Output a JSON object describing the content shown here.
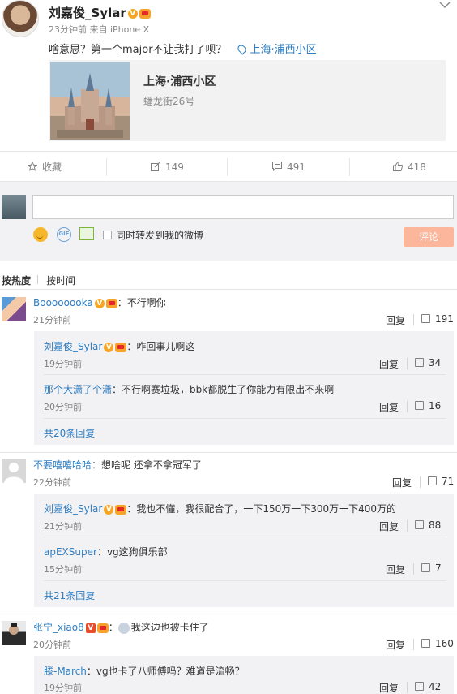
{
  "post": {
    "author": "刘嘉俊_Sylar",
    "meta": "23分钟前 来自 iPhone X",
    "text": "啥意思？第一个major不让我打了呗？",
    "location_link": "上海·浦西小区",
    "location_card": {
      "title": "上海·浦西小区",
      "address": "蟠龙街26号"
    }
  },
  "actions": {
    "favorite": "收藏",
    "forward": "149",
    "comment": "491",
    "like": "418"
  },
  "compose": {
    "forward_label": "同时转发到我的微博",
    "submit": "评论"
  },
  "sort": {
    "hot": "按热度",
    "time": "按时间"
  },
  "comments": [
    {
      "user": "Boooooooka",
      "text": "：不行啊你",
      "time": "21分钟前",
      "reply": "回复",
      "likes": "191",
      "sub": [
        {
          "user": "刘嘉俊_Sylar",
          "text": "：咋回事儿啊这",
          "time": "19分钟前",
          "reply": "回复",
          "likes": "34"
        },
        {
          "user": "那个大潇了个潇",
          "text": "：不行啊赛垃圾，bbk都脱生了你能力有限出不来啊",
          "time": "20分钟前",
          "reply": "回复",
          "likes": "16"
        }
      ],
      "more": "共20条回复"
    },
    {
      "user": "不要嘻嘻哈哈",
      "text": "：想啥呢 还拿不拿冠军了",
      "time": "22分钟前",
      "reply": "回复",
      "likes": "71",
      "sub": [
        {
          "user": "刘嘉俊_Sylar",
          "text": "：我也不懂，我很配合了，一下150万一下300万一下400万的",
          "time": "21分钟前",
          "reply": "回复",
          "likes": "88"
        },
        {
          "user": "apEXSuper",
          "text": "：vg这狗俱乐部",
          "time": "15分钟前",
          "reply": "回复",
          "likes": "7"
        }
      ],
      "more": "共21条回复"
    },
    {
      "user": "张宁_xiao8",
      "text": "我这边也被卡住了",
      "time": "20分钟前",
      "reply": "回复",
      "likes": "160",
      "sub": [
        {
          "user": "滕-March",
          "text": "：vg也卡了八师傅吗？难道是流畅？",
          "time": "19分钟前",
          "reply": "回复",
          "likes": "42"
        }
      ]
    }
  ],
  "colors": {
    "link": "#2e7dc1",
    "submit_bg": "#fbb69b",
    "sub_bg": "#f2f2f5"
  },
  "icons": [
    "chevron-down-icon",
    "location-pin-icon",
    "star-icon",
    "share-icon",
    "comment-icon",
    "thumbs-up-icon",
    "emoji-icon",
    "gif-icon",
    "image-icon",
    "verified-icon",
    "vip-crown-icon"
  ]
}
